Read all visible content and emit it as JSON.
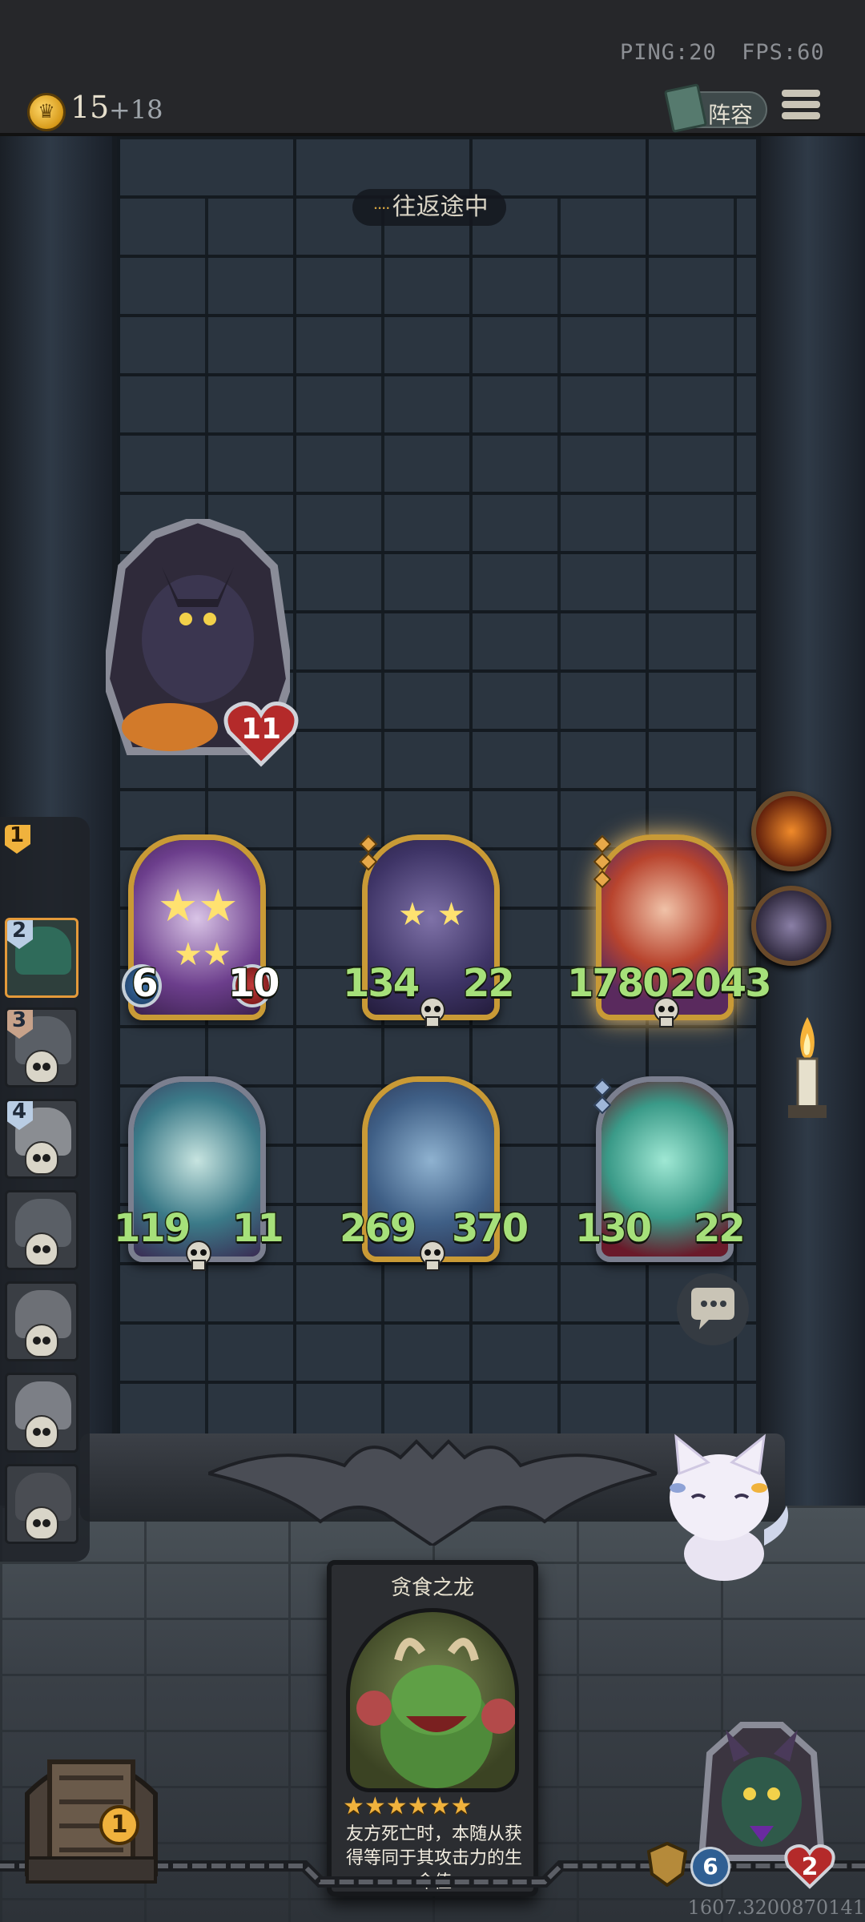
{
  "hud": {
    "ping_label": "PING:20",
    "fps_label": "FPS:60",
    "gold": "15",
    "gold_gain": "+18",
    "lineup_label": "阵容",
    "travel_status": "往返途中"
  },
  "opponent": {
    "health": "11"
  },
  "rounds": [
    {
      "num": "1",
      "state": "current"
    },
    {
      "num": "2",
      "state": "active"
    },
    {
      "num": "3",
      "state": "defeated"
    },
    {
      "num": "4",
      "state": "defeated"
    },
    {
      "num": "",
      "state": "defeated"
    },
    {
      "num": "",
      "state": "defeated"
    },
    {
      "num": "",
      "state": "defeated"
    },
    {
      "num": "",
      "state": "defeated"
    }
  ],
  "units": [
    {
      "attack": "6",
      "health": "10"
    },
    {
      "attack": "134",
      "health": "22"
    },
    {
      "attack": "1780",
      "health": "2043"
    },
    {
      "attack": "119",
      "health": "11"
    },
    {
      "attack": "269",
      "health": "370"
    },
    {
      "attack": "130",
      "health": "22"
    }
  ],
  "featured_card": {
    "title": "贪食之龙",
    "stars": "★★★★★★",
    "description": "友方死亡时，本随从获得等同于其攻击力的生命值"
  },
  "bottom": {
    "chest_count": "1",
    "player_attack": "6",
    "player_health": "2",
    "timestamp": "1607.3200870141"
  },
  "colors": {
    "accent_gold": "#c99a36",
    "stat_green": "#a6e07a",
    "health_red": "#c23b3b",
    "attack_blue": "#3b6fa8"
  }
}
